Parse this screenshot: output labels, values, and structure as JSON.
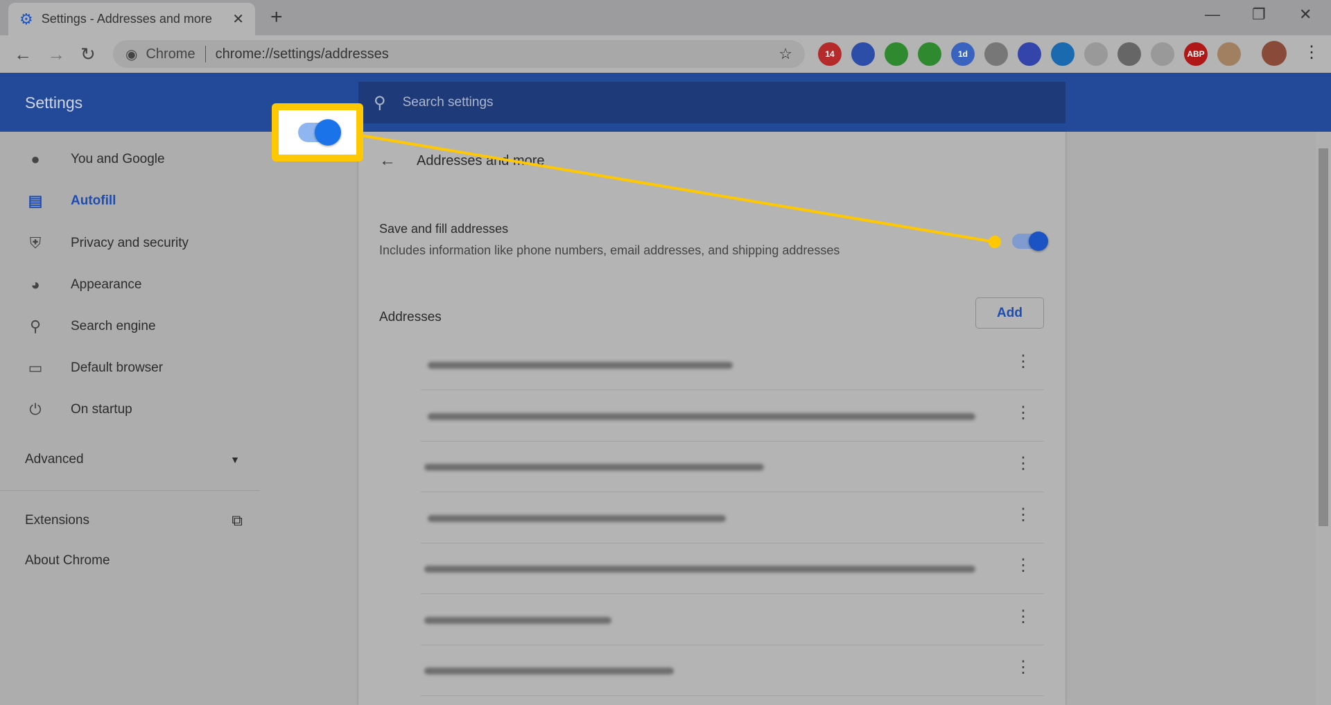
{
  "browser": {
    "tab_title": "Settings - Addresses and more",
    "tab_icon": "gear-icon",
    "new_tab": "+",
    "omnibox_site": "Chrome",
    "omnibox_url": "chrome://settings/addresses",
    "extensions": [
      {
        "name": "todoist",
        "badge": "14",
        "color": "#b52a2a"
      },
      {
        "name": "vimeo-like",
        "color": "#2c4ea8"
      },
      {
        "name": "evernote",
        "color": "#2f8a2f"
      },
      {
        "name": "d-ext",
        "color": "#2f8a2f"
      },
      {
        "name": "calendar",
        "badge": "1d",
        "color": "#3a63c0"
      },
      {
        "name": "bird",
        "color": "#777"
      },
      {
        "name": "v-ext",
        "color": "#3344aa"
      },
      {
        "name": "circle",
        "color": "#1a6ab0"
      },
      {
        "name": "plus-doc",
        "color": "#999"
      },
      {
        "name": "sphere",
        "color": "#666"
      },
      {
        "name": "shield",
        "color": "#999"
      },
      {
        "name": "adblock",
        "label": "ABP",
        "color": "#b01818"
      },
      {
        "name": "clipboard",
        "color": "#a08060"
      }
    ]
  },
  "header": {
    "title": "Settings",
    "search_placeholder": "Search settings"
  },
  "sidebar": {
    "items": [
      {
        "label": "You and Google",
        "icon": "person-icon"
      },
      {
        "label": "Autofill",
        "icon": "clipboard-icon",
        "active": true
      },
      {
        "label": "Privacy and security",
        "icon": "shield-icon"
      },
      {
        "label": "Appearance",
        "icon": "palette-icon"
      },
      {
        "label": "Search engine",
        "icon": "search-icon"
      },
      {
        "label": "Default browser",
        "icon": "browser-icon"
      },
      {
        "label": "On startup",
        "icon": "power-icon"
      }
    ],
    "advanced": "Advanced",
    "extensions": "Extensions",
    "about": "About Chrome"
  },
  "main": {
    "title": "Addresses and more",
    "save_label": "Save and fill addresses",
    "save_desc": "Includes information like phone numbers, email addresses, and shipping addresses",
    "save_enabled": true,
    "addresses_label": "Addresses",
    "add_button": "Add",
    "address_count": 7
  },
  "annotation": {
    "color": "#ffc800",
    "toggle_on": true
  }
}
